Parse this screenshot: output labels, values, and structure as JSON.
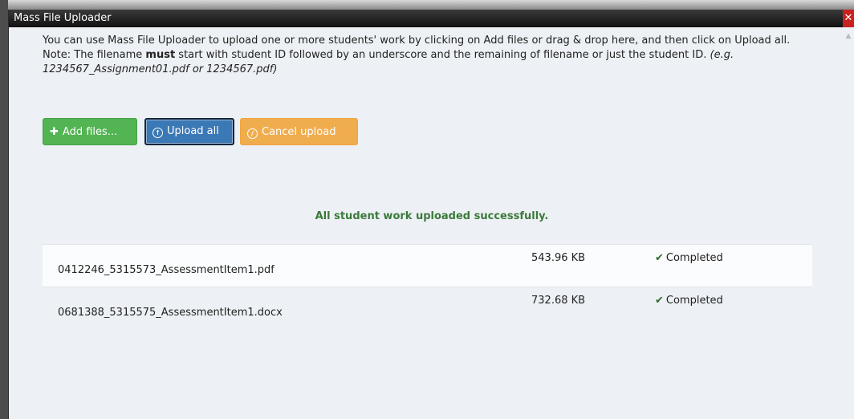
{
  "window": {
    "title": "Mass File Uploader",
    "close_label": "✕"
  },
  "instructions": {
    "intro": "You can use Mass File Uploader to upload one or more students' work by clicking on Add files or drag & drop here, and then click on Upload all.",
    "note_prefix": "Note: The filename ",
    "note_bold": "must",
    "note_suffix": " start with student ID followed by an underscore and the remaining of filename or just the student ID. ",
    "note_example": "(e.g. 1234567_Assignment01.pdf or 1234567.pdf)"
  },
  "toolbar": {
    "add_label": "Add files...",
    "upload_label": "Upload all",
    "cancel_label": "Cancel upload"
  },
  "status": {
    "message": "All student work uploaded successfully."
  },
  "files": [
    {
      "name": "0412246_5315573_AssessmentItem1.pdf",
      "size": "543.96 KB",
      "status": "Completed"
    },
    {
      "name": "0681388_5315575_AssessmentItem1.docx",
      "size": "732.68 KB",
      "status": "Completed"
    }
  ],
  "colors": {
    "add_button": "#52b452",
    "upload_button": "#3b78b6",
    "cancel_button": "#f0ad4e",
    "success_text": "#3a7a3a"
  }
}
